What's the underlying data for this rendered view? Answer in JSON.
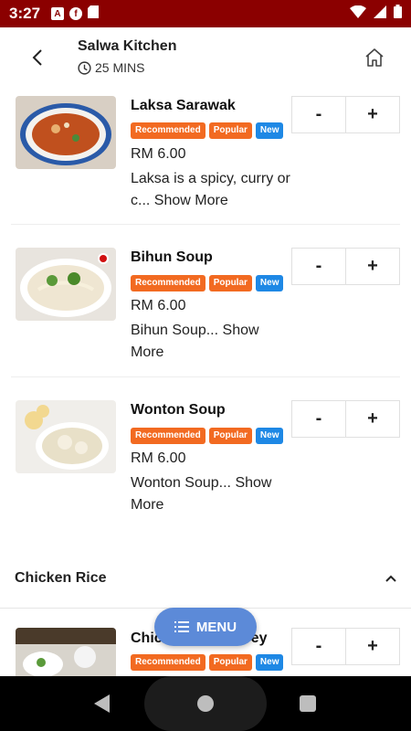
{
  "status_bar": {
    "time": "3:27",
    "left_icons": [
      "A",
      "f"
    ]
  },
  "header": {
    "store_name": "Salwa Kitchen",
    "eta": "25 MINS"
  },
  "items": [
    {
      "title": "Laksa Sarawak",
      "badges": [
        "Recommended",
        "Popular",
        "New"
      ],
      "price": "RM 6.00",
      "desc": "Laksa is a spicy, curry or c...",
      "show_more": "Show More",
      "stepper_minus": "-",
      "stepper_plus": "+"
    },
    {
      "title": "Bihun Soup",
      "badges": [
        "Recommended",
        "Popular",
        "New"
      ],
      "price": "RM 6.00",
      "desc": "Bihun Soup...",
      "show_more": "Show More",
      "stepper_minus": "-",
      "stepper_plus": "+"
    },
    {
      "title": "Wonton Soup",
      "badges": [
        "Recommended",
        "Popular",
        "New"
      ],
      "price": "RM 6.00",
      "desc": "Wonton Soup...",
      "show_more": "Show More",
      "stepper_minus": "-",
      "stepper_plus": "+"
    },
    {
      "title": "Chic",
      "title_tail": "ey",
      "badges": [
        "Recommended",
        "Popular",
        "New"
      ],
      "stepper_minus": "-",
      "stepper_plus": "+"
    }
  ],
  "section": {
    "title": "Chicken Rice"
  },
  "fab": {
    "label": "MENU"
  },
  "colors": {
    "status_bar": "#8b0000",
    "badge_orange": "#f26a21",
    "badge_blue": "#1e88e5",
    "fab": "#5c8ad8"
  },
  "icons": [
    "back-arrow-icon",
    "clock-icon",
    "home-icon",
    "chevron-up-icon",
    "list-icon",
    "nav-back-icon",
    "nav-home-icon",
    "nav-recent-icon"
  ]
}
